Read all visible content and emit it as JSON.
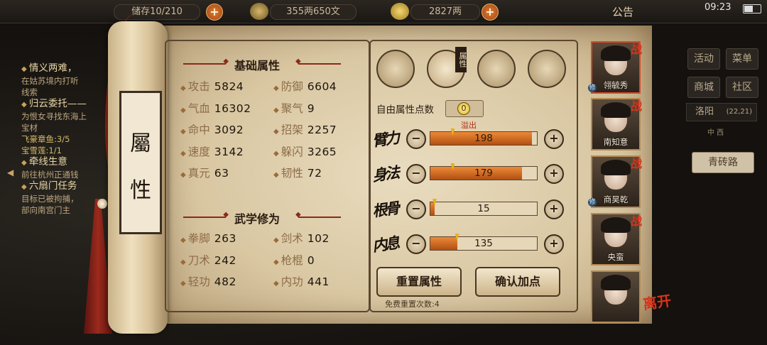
{
  "topbar": {
    "bag_label": "储存",
    "bag_count": "10/210",
    "money": "355两650文",
    "gold": "2827两",
    "notice": "公告",
    "time": "09:23"
  },
  "quests": [
    {
      "title": "情义两难，",
      "lines": [
        "在姑苏境内打听",
        "线索"
      ]
    },
    {
      "title": "归云委托——",
      "lines": [
        "为恨女寻找东海上",
        "宝材"
      ],
      "progress": [
        "飞豪章鱼:3/5",
        "宝雪莲:1/1"
      ]
    },
    {
      "title": "牵线生意",
      "lines": [
        "前往杭州正通钱"
      ]
    },
    {
      "title": "六扇门任务",
      "lines": [
        "目标已被拘捕，",
        "部向南宫门主"
      ]
    }
  ],
  "scroll": {
    "char1": "屬",
    "char2": "性"
  },
  "basic": {
    "title": "基础属性",
    "stats": [
      {
        "label": "攻击",
        "value": "5824"
      },
      {
        "label": "防御",
        "value": "6604"
      },
      {
        "label": "气血",
        "value": "16302"
      },
      {
        "label": "聚气",
        "value": "9"
      },
      {
        "label": "命中",
        "value": "3092"
      },
      {
        "label": "招架",
        "value": "2257"
      },
      {
        "label": "速度",
        "value": "3142"
      },
      {
        "label": "躲闪",
        "value": "3265"
      },
      {
        "label": "真元",
        "value": "63"
      },
      {
        "label": "韧性",
        "value": "72"
      }
    ]
  },
  "martial": {
    "title": "武学修为",
    "stats": [
      {
        "label": "拳脚",
        "value": "263"
      },
      {
        "label": "剑术",
        "value": "102"
      },
      {
        "label": "刀术",
        "value": "242"
      },
      {
        "label": "枪棍",
        "value": "0"
      },
      {
        "label": "轻功",
        "value": "482"
      },
      {
        "label": "内功",
        "value": "441"
      }
    ]
  },
  "attr_tabs": [
    "hat-icon",
    "chest-icon",
    "bagua-icon",
    "body-icon"
  ],
  "attr_tag": "属性",
  "free_points": {
    "label": "自由属性点数",
    "value": "0"
  },
  "attributes": [
    {
      "name": "臂力",
      "value": "198",
      "fill": 0.95,
      "marker": 0.21
    },
    {
      "name": "身法",
      "value": "179",
      "fill": 0.86,
      "marker": 0.21
    },
    {
      "name": "根骨",
      "value": "15",
      "fill": 0.04,
      "marker": 0.04
    },
    {
      "name": "内息",
      "value": "135",
      "fill": 0.25,
      "marker": 0.25
    }
  ],
  "overflow_label": "溢出",
  "buttons": {
    "reset": "重置属性",
    "confirm": "确认加点"
  },
  "reset_count": "免费重置次数:4",
  "party": [
    {
      "name": "翎毓秀",
      "war": "战",
      "xiu": "修"
    },
    {
      "name": "南知意",
      "war": "战",
      "xiu": ""
    },
    {
      "name": "商昊乾",
      "war": "战",
      "xiu": "修"
    },
    {
      "name": "央蛮",
      "war": "战",
      "xiu": ""
    },
    {
      "name": "",
      "war": "",
      "xiu": ""
    }
  ],
  "leave": "离开",
  "right_menu": {
    "items": [
      "活动",
      "菜单",
      "商城",
      "社区"
    ],
    "location": "洛阳",
    "coords": "(22,21)",
    "dirs": "中 西",
    "road": "青砖路"
  }
}
